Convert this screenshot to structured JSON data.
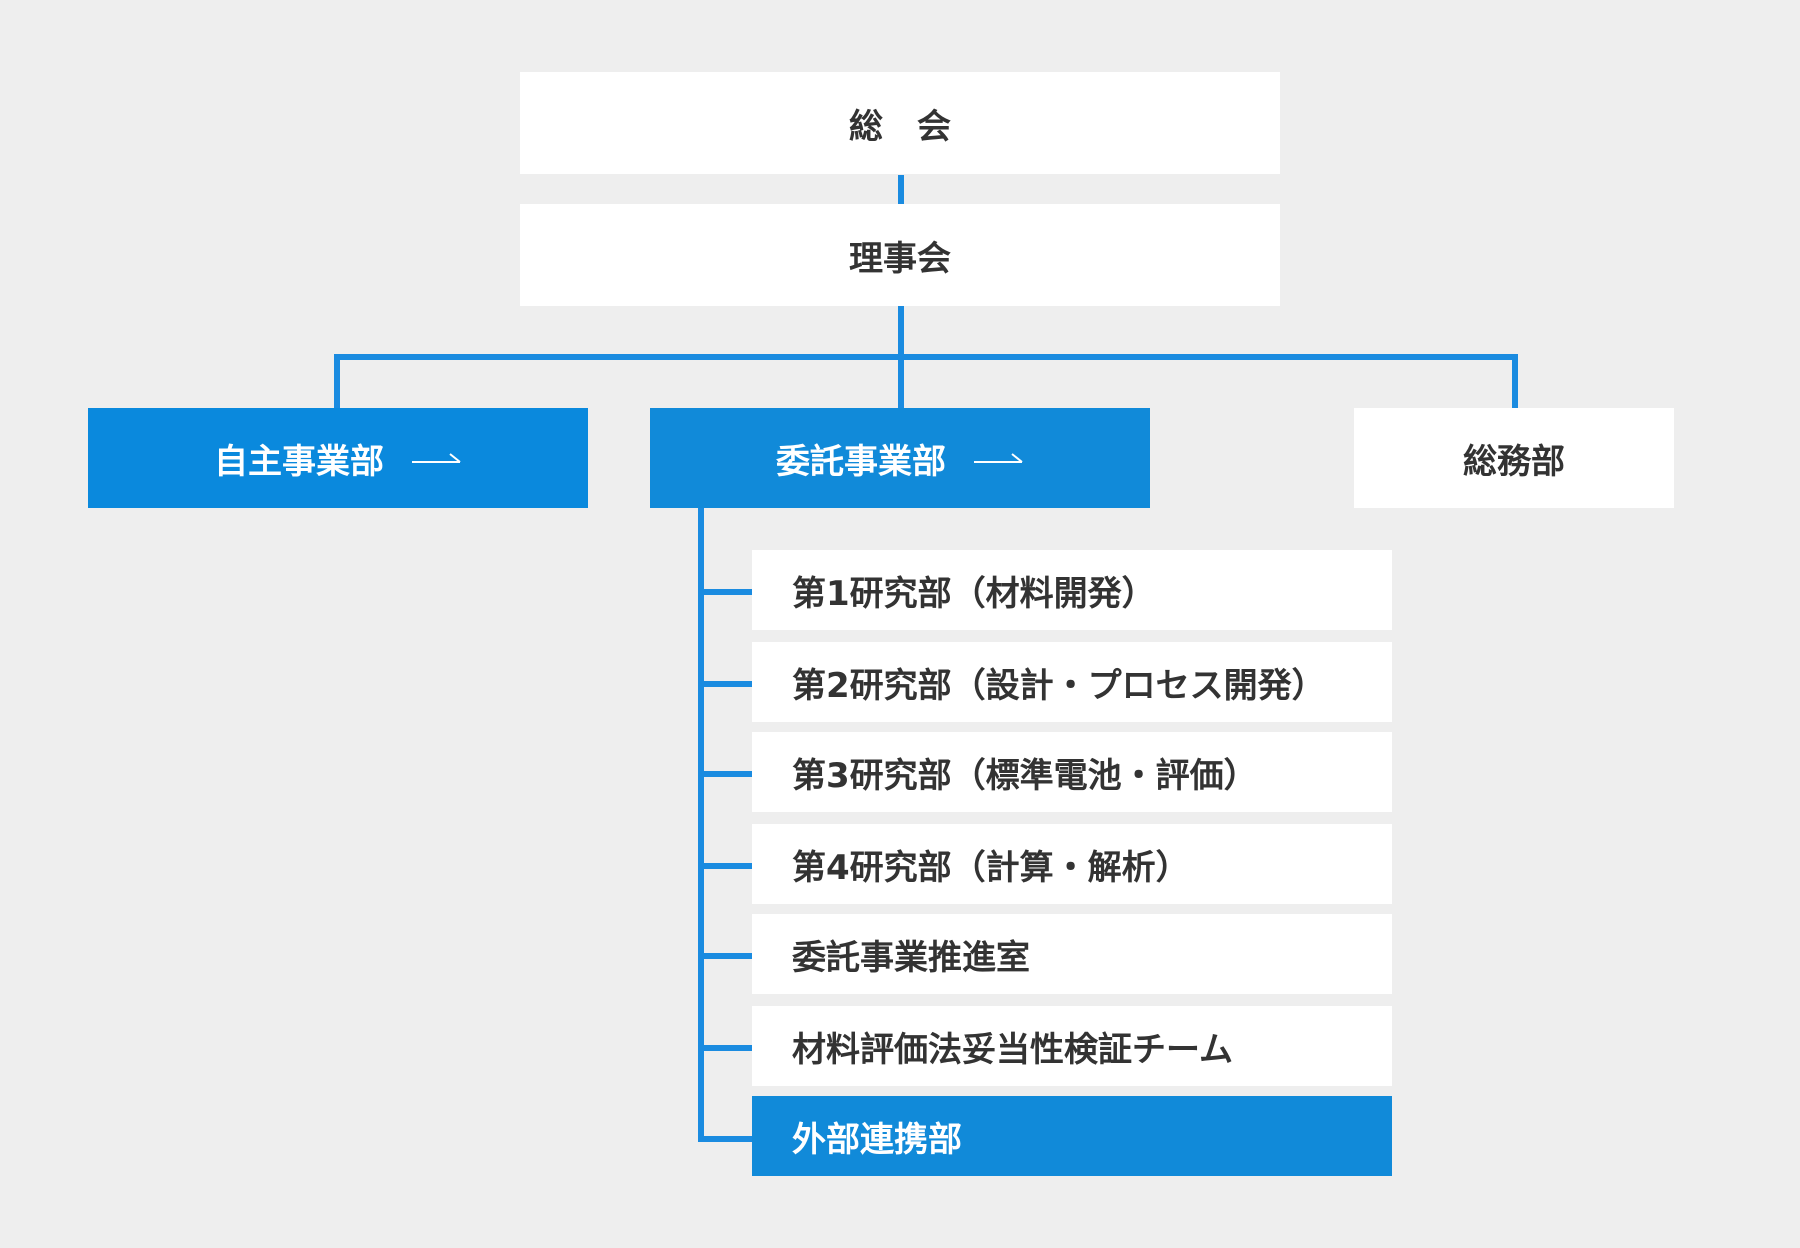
{
  "colors": {
    "background": "#eeeeee",
    "box": "#ffffff",
    "accent": "#118ad9",
    "connector": "#1a8be0",
    "text_dark": "#333333",
    "text_light": "#ffffff"
  },
  "general_assembly": "総　会",
  "board": "理事会",
  "divisions": [
    {
      "label": "自主事業部",
      "has_arrow": true,
      "arrow_icon": "long-right-arrow-icon"
    },
    {
      "label": "委託事業部",
      "has_arrow": true,
      "arrow_icon": "long-right-arrow-icon"
    },
    {
      "label": "総務部",
      "has_arrow": false
    }
  ],
  "commissioned_units": [
    {
      "label": "第1研究部（材料開発）"
    },
    {
      "label": "第2研究部（設計・プロセス開発）"
    },
    {
      "label": "第3研究部（標準電池・評価）"
    },
    {
      "label": "第4研究部（計算・解析）"
    },
    {
      "label": "委託事業推進室"
    },
    {
      "label": "材料評価法妥当性検証チーム"
    },
    {
      "label": "外部連携部",
      "highlighted": true
    }
  ]
}
